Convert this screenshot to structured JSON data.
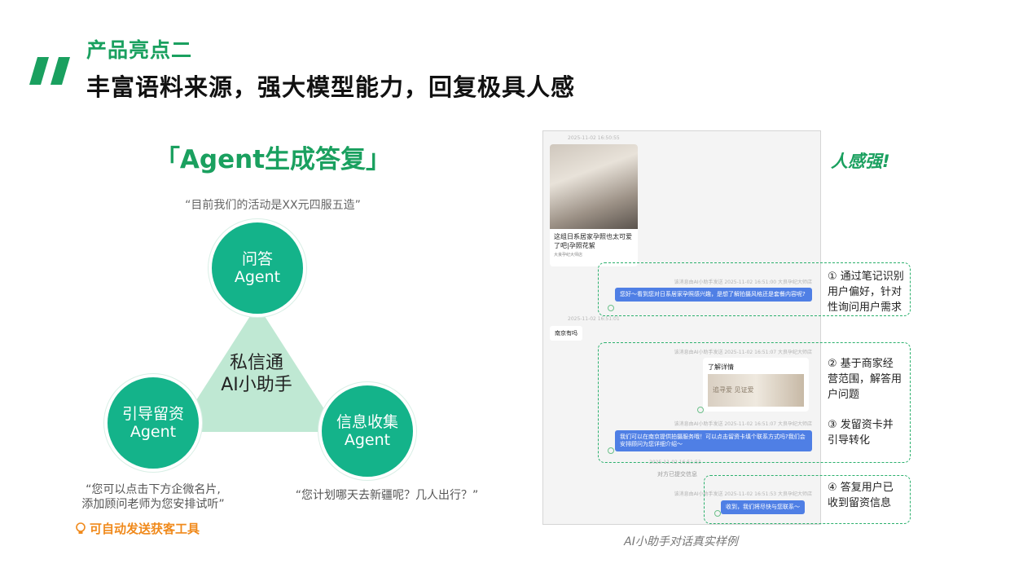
{
  "header": {
    "eyebrow": "产品亮点二",
    "headline": "丰富语料来源，强大模型能力，回复极具人感"
  },
  "left": {
    "title": "「Agent生成答复」",
    "example_top": "“目前我们的活动是XX元四服五造”",
    "center": {
      "line1": "私信通",
      "line2": "AI小助手"
    },
    "agents": [
      {
        "line1": "问答",
        "line2": "Agent"
      },
      {
        "line1": "引导留资",
        "line2": "Agent"
      },
      {
        "line1": "信息收集",
        "line2": "Agent"
      }
    ],
    "example_left": {
      "line1": "“您可以点击下方企微名片,",
      "line2": "添加顾问老师为您安排试听”"
    },
    "example_right": "“您计划哪天去新疆呢？几人出行？”",
    "tip": "可自动发送获客工具",
    "colors": {
      "brand_green": "#1aa05f",
      "circle": "#14b38a",
      "triangle": "#bfe8d3",
      "tip": "#f08a1c"
    }
  },
  "chat": {
    "ts1": "2025-11-02 16:50:55",
    "card_title": "这组日系居家孕照也太可爱了吧|孕照花絮",
    "card_author": "大良孕纪大师店",
    "sys1": "该消息由AI小助手发送  2025-11-02 16:51:00 大良孕纪大师店",
    "msg1": "您好～看到您对日系居家孕照感兴趣，是想了解拍摄风格还是套餐内容呢?",
    "ts2": "2025-11-02 16:51:01",
    "user_msg": "南京有吗",
    "sys2": "该消息由AI小助手发送  2025-11-02 16:51:07 大良孕纪大师店",
    "link_title": "了解详情",
    "link_img_text": "追寻爱 见证爱",
    "sys3": "该消息由AI小助手发送  2025-11-02 16:51:07 大良孕纪大师店",
    "msg2": "我们可以在南京提供拍摄服务哦！可以点击留资卡填个联系方式吗?我们会安排顾问为您详细介绍～",
    "ts3": "2025-11-02 16:51:53",
    "submitted": "对方已提交信息",
    "sys4": "该消息由AI小助手发送  2025-11-02 16:51:53 大良孕纪大师店",
    "msg3": "收到，我们将尽快与您联系～"
  },
  "notes": {
    "rengan": "人感强!",
    "n1": [
      "① 通过笔记识别",
      "用户偏好，针对",
      "性询问用户需求"
    ],
    "n2": [
      "② 基于商家经",
      "营范围，解答用",
      "户问题"
    ],
    "n3": [
      "③ 发留资卡并",
      "引导转化"
    ],
    "n4": [
      "④ 答复用户已",
      "收到留资信息"
    ]
  },
  "caption": "AI小助手对话真实样例"
}
